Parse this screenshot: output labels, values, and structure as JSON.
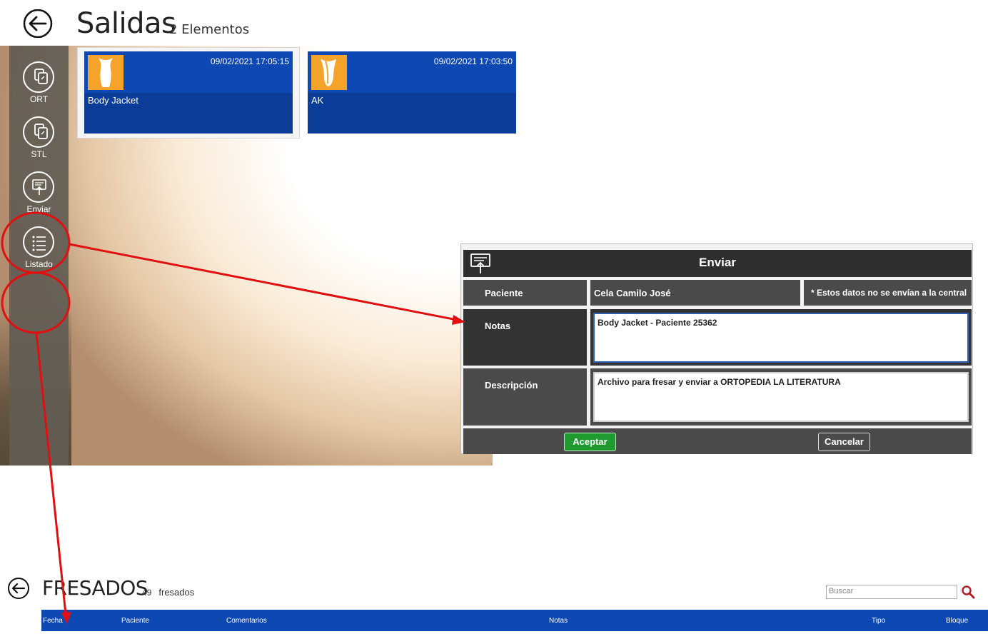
{
  "salidas": {
    "title": "Salidas",
    "count_label": "2 Elementos",
    "sidebar": [
      {
        "label": "ORT",
        "icon": "document-copy-icon"
      },
      {
        "label": "STL",
        "icon": "document-copy-icon"
      },
      {
        "label": "Enviar",
        "icon": "send-upload-icon"
      },
      {
        "label": "Listado",
        "icon": "list-icon"
      }
    ],
    "tiles": [
      {
        "date": "09/02/2021 17:05:15",
        "name": "Body Jacket",
        "icon": "body-jacket-icon"
      },
      {
        "date": "09/02/2021 17:03:50",
        "name": "AK",
        "icon": "ak-socket-icon"
      }
    ]
  },
  "dialog": {
    "title": "Enviar",
    "paciente_label": "Paciente",
    "paciente_value": "Cela Camilo José",
    "note": "* Estos datos no se envían a la central",
    "notas_label": "Notas",
    "notas_value": "Body Jacket - Paciente 25362",
    "descripcion_label": "Descripción",
    "descripcion_value": "Archivo para fresar y enviar a ORTOPEDIA LA LITERATURA",
    "accept_label": "Aceptar",
    "cancel_label": "Cancelar"
  },
  "fresados": {
    "title": "FRESADOS",
    "count": "49",
    "count_suffix": "fresados",
    "search_placeholder": "Buscar",
    "columns": [
      "Fecha",
      "Paciente",
      "Comentarios",
      "Notas",
      "Tipo",
      "Bloque"
    ]
  },
  "colors": {
    "tile_blue": "#0d48b3",
    "tile_orange": "#f6a429",
    "annotation_red": "#e01010",
    "accept_green": "#1f9a2e"
  }
}
